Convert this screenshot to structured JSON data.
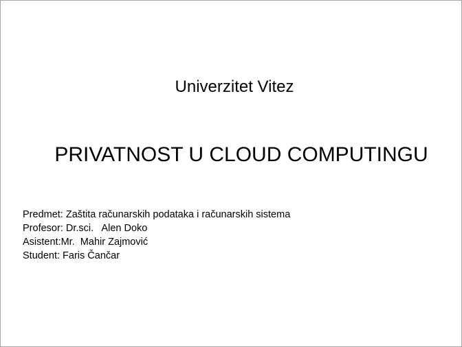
{
  "slide": {
    "university": "Univerzitet Vitez",
    "title": "PRIVATNOST U CLOUD COMPUTINGU",
    "info": [
      "Predmet: Zaštita računarskih podataka i računarskih sistema",
      "Profesor: Dr.sci.   Alen Doko",
      "Asistent:Mr.  Mahir Zajmović",
      "Student: Faris Čančar"
    ]
  }
}
